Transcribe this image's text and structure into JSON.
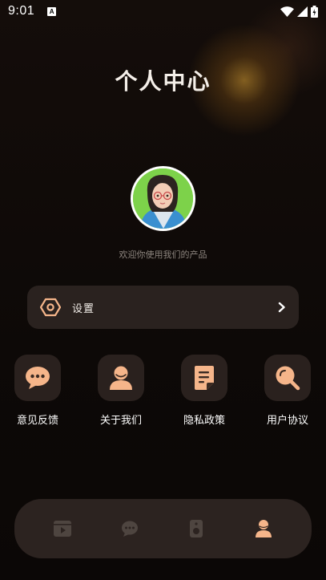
{
  "status_bar": {
    "time": "9:01",
    "notification_icon_letter": "A",
    "icons": [
      "wifi-icon",
      "signal-icon",
      "battery-icon"
    ]
  },
  "page": {
    "title": "个人中心",
    "welcome": "欢迎你使用我们的产品"
  },
  "settings_row": {
    "label": "设置",
    "icon": "hexagon-gear-icon",
    "arrow_icon": "chevron-right-icon"
  },
  "features": [
    {
      "label": "意见反馈",
      "icon": "chat-bubble-icon"
    },
    {
      "label": "关于我们",
      "icon": "person-icon"
    },
    {
      "label": "隐私政策",
      "icon": "document-icon"
    },
    {
      "label": "用户协议",
      "icon": "magnifier-icon"
    }
  ],
  "tabbar": {
    "tabs": [
      {
        "icon": "video-icon",
        "active": false
      },
      {
        "icon": "message-icon",
        "active": false
      },
      {
        "icon": "speaker-icon",
        "active": false
      },
      {
        "icon": "profile-icon",
        "active": true
      }
    ]
  },
  "colors": {
    "accent": "#f5b58a",
    "accent_dark": "#3a2a22",
    "inactive_tab": "#4e4540",
    "card": "#2a221f"
  }
}
